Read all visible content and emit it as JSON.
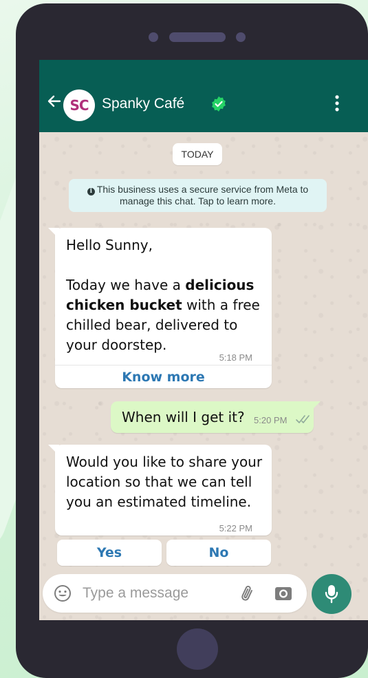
{
  "chat": {
    "contact_name": "Spanky Café",
    "avatar_initials": "SC",
    "date_label": "TODAY",
    "security_note": "This business uses a secure service from Meta to manage this chat. Tap to learn more.",
    "info_glyph": "i"
  },
  "messages": [
    {
      "direction": "incoming",
      "greeting": "Hello Sunny,",
      "text_prefix": "Today we have a ",
      "text_bold": "delicious chicken bucket",
      "text_suffix": " with a free chilled bear, delivered to your doorstep.",
      "time": "5:18 PM",
      "action_label": "Know more"
    },
    {
      "direction": "outgoing",
      "text": "When will I get it?",
      "time": "5:20 PM",
      "status_icon": "double-check-icon"
    },
    {
      "direction": "incoming",
      "text": "Would you like to share your location so that we can tell you an estimated timeline.",
      "time": "5:22 PM",
      "quick_replies": [
        "Yes",
        "No"
      ]
    }
  ],
  "composer": {
    "placeholder": "Type a message",
    "icons": [
      "emoji-icon",
      "paperclip-icon",
      "camera-icon",
      "mic-icon"
    ]
  },
  "colors": {
    "header": "#075e54",
    "outgoing_bubble": "#dcf8c6",
    "link_blue": "#2d78b3",
    "mic_button": "#2e8b76",
    "phone_body": "#2a2832"
  }
}
